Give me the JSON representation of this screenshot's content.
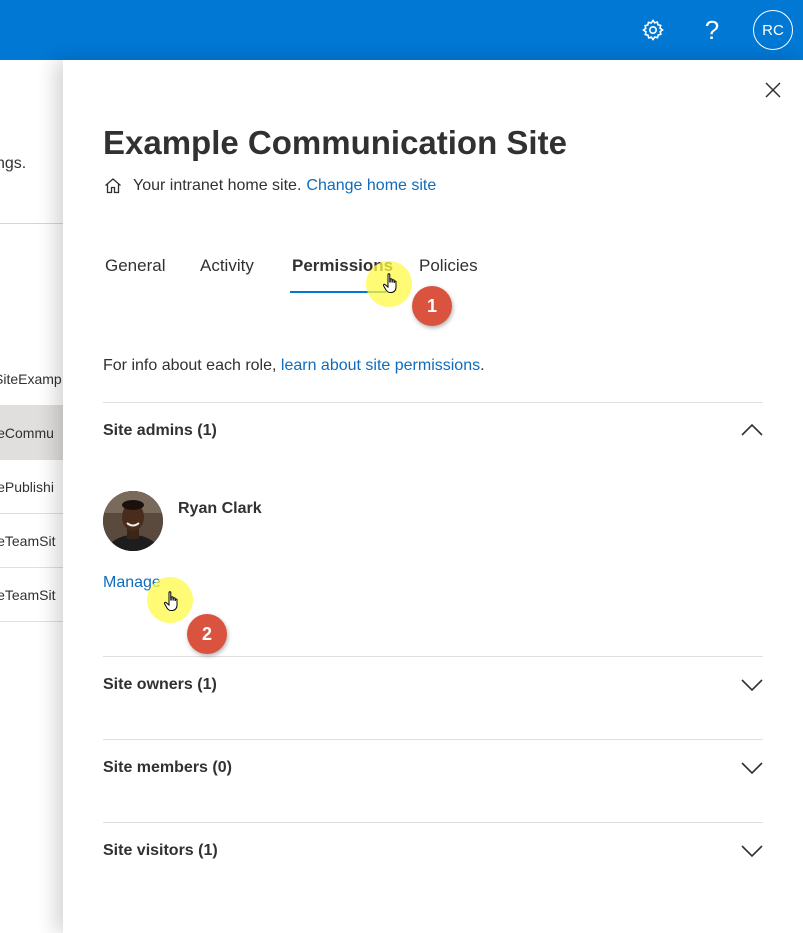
{
  "topbar": {
    "settings_icon": "gear-icon",
    "help_icon": "help-icon",
    "help_glyph": "?",
    "avatar_initials": "RC"
  },
  "background_page": {
    "description_fragment": "ngs.",
    "rows": [
      {
        "text": "SiteExamp",
        "selected": false
      },
      {
        "text": "leCommu",
        "selected": true
      },
      {
        "text": "lePublishi",
        "selected": false
      },
      {
        "text": "leTeamSit",
        "selected": false
      },
      {
        "text": "leTeamSit",
        "selected": false
      }
    ]
  },
  "panel": {
    "title": "Example Communication Site",
    "home": {
      "text": "Your intranet home site.",
      "link": "Change home site"
    },
    "tabs": [
      {
        "label": "General",
        "active": false
      },
      {
        "label": "Activity",
        "active": false
      },
      {
        "label": "Permissions",
        "active": true
      },
      {
        "label": "Policies",
        "active": false
      }
    ],
    "info": {
      "text": "For info about each role,",
      "link": "learn about site permissions",
      "end": "."
    },
    "sections": [
      {
        "title": "Site admins (1)",
        "expanded": true
      },
      {
        "title": "Site owners (1)",
        "expanded": false
      },
      {
        "title": "Site members (0)",
        "expanded": false
      },
      {
        "title": "Site visitors (1)",
        "expanded": false
      }
    ],
    "admin": {
      "name": "Ryan Clark",
      "manage_label": "Manage"
    }
  },
  "annotations": {
    "step1": "1",
    "step2": "2",
    "highlight_color": "#fffa46",
    "badge_color": "#d9533e"
  },
  "colors": {
    "brand": "#0078d4",
    "link": "#0f6cbd",
    "text": "#323130"
  }
}
